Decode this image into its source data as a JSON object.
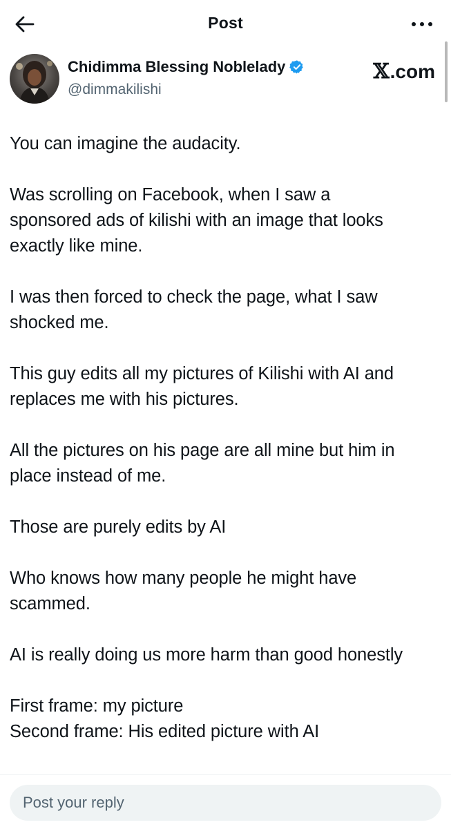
{
  "header": {
    "title": "Post"
  },
  "author": {
    "name": "Chidimma Blessing Noblelady",
    "handle": "@dimmakilishi"
  },
  "watermark": {
    "x_glyph": "𝕏",
    "domain": ".com"
  },
  "post": {
    "paragraphs": [
      [
        "You can imagine the audacity."
      ],
      [
        "Was scrolling on Facebook, when I saw a",
        "sponsored ads of kilishi with an image that looks",
        "exactly like mine."
      ],
      [
        "I was then forced to check the page, what I saw",
        "shocked me."
      ],
      [
        "This guy edits all my pictures of Kilishi with AI and",
        "replaces me with his pictures."
      ],
      [
        "All the pictures on his page are all mine but him in",
        "place instead of me."
      ],
      [
        "Those are purely edits by AI"
      ],
      [
        "Who knows how many people he might have",
        "scammed."
      ],
      [
        "AI is really doing us more harm than good honestly"
      ],
      [
        "First frame: my picture",
        "Second frame: His edited picture with AI"
      ]
    ]
  },
  "reply": {
    "placeholder": "Post your reply"
  },
  "colors": {
    "text": "#0f1419",
    "secondary_text": "#536471",
    "verified": "#1d9bf0",
    "reply_bg": "#eff3f4"
  },
  "icons": {
    "back": "arrow-left-icon",
    "more": "more-horizontal-icon",
    "verified": "verified-badge-icon"
  }
}
